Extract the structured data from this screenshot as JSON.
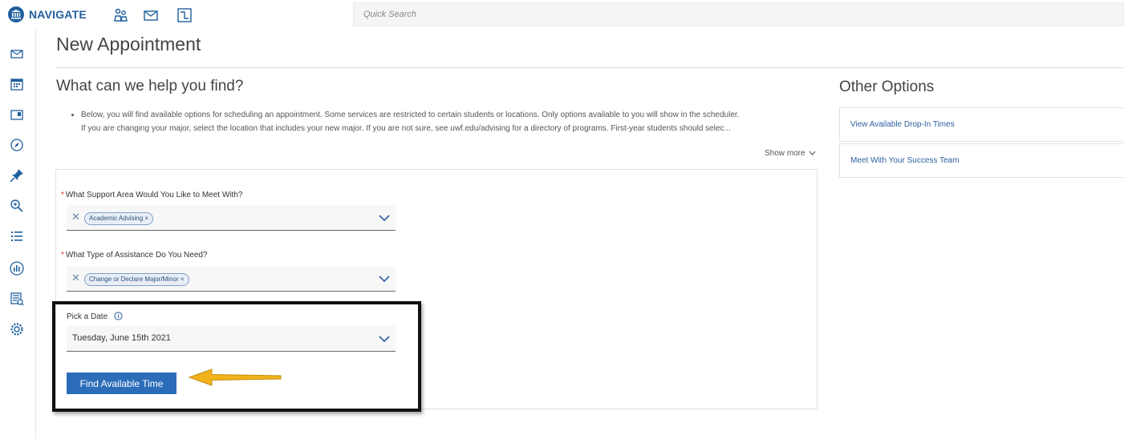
{
  "app": {
    "name": "NAVIGATE"
  },
  "search": {
    "placeholder": "Quick Search"
  },
  "page": {
    "title": "New Appointment"
  },
  "help": {
    "heading": "What can we help you find?",
    "bullets": [
      "Below, you will find available options for scheduling an appointment. Some services are restricted to certain students or locations. Only options available to you will show in the scheduler.",
      "If you are changing your major, select the location that includes your new major. If you are not sure, see uwf.edu/advising for a directory of programs. First-year students should selec..."
    ],
    "show_more": "Show more"
  },
  "form": {
    "support_area": {
      "label": "What Support Area Would You Like to Meet With?",
      "value": "Academic Advising"
    },
    "assistance_type": {
      "label": "What Type of Assistance Do You Need?",
      "value": "Change or Declare Major/Minor"
    },
    "date": {
      "label": "Pick a Date",
      "value": "Tuesday, June 15th 2021"
    },
    "find_button": "Find Available Time"
  },
  "other_options": {
    "heading": "Other Options",
    "items": [
      "View Available Drop-In Times",
      "Meet With Your Success Team"
    ]
  },
  "colors": {
    "brand": "#1f5f9e",
    "button": "#2c6db9",
    "required": "#d0342c",
    "arrow": "#f2b21b"
  },
  "icons": {
    "top": [
      "students-icon",
      "mail-icon",
      "flowchart-icon"
    ],
    "sidebar": [
      "mail-icon",
      "calendar-icon",
      "folder-icon",
      "compass-icon",
      "pin-icon",
      "zoom-icon",
      "list-icon",
      "chart-icon",
      "report-icon",
      "gear-icon"
    ]
  }
}
